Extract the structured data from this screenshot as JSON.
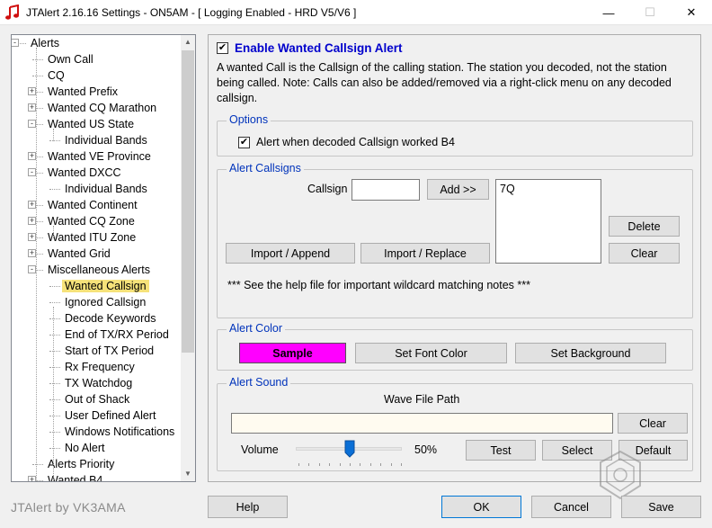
{
  "window": {
    "title": "JTAlert 2.16.16 Settings  -  ON5AM  -  [ Logging Enabled - HRD V5/V6 ]",
    "minimize": "—",
    "maximize": "☐",
    "close": "✕"
  },
  "tree": {
    "items": [
      {
        "label": "Alerts",
        "level": 0,
        "expander": "-"
      },
      {
        "label": "Own Call",
        "level": 1,
        "expander": ""
      },
      {
        "label": "CQ",
        "level": 1,
        "expander": ""
      },
      {
        "label": "Wanted Prefix",
        "level": 1,
        "expander": "+"
      },
      {
        "label": "Wanted CQ Marathon",
        "level": 1,
        "expander": "+"
      },
      {
        "label": "Wanted US State",
        "level": 1,
        "expander": "-"
      },
      {
        "label": "Individual Bands",
        "level": 2,
        "expander": ""
      },
      {
        "label": "Wanted VE Province",
        "level": 1,
        "expander": "+"
      },
      {
        "label": "Wanted DXCC",
        "level": 1,
        "expander": "-"
      },
      {
        "label": "Individual Bands",
        "level": 2,
        "expander": ""
      },
      {
        "label": "Wanted Continent",
        "level": 1,
        "expander": "+"
      },
      {
        "label": "Wanted CQ Zone",
        "level": 1,
        "expander": "+"
      },
      {
        "label": "Wanted ITU Zone",
        "level": 1,
        "expander": "+"
      },
      {
        "label": "Wanted Grid",
        "level": 1,
        "expander": "+"
      },
      {
        "label": "Miscellaneous Alerts",
        "level": 1,
        "expander": "-"
      },
      {
        "label": "Wanted Callsign",
        "level": 2,
        "expander": "",
        "selected": true
      },
      {
        "label": "Ignored Callsign",
        "level": 2,
        "expander": ""
      },
      {
        "label": "Decode Keywords",
        "level": 2,
        "expander": ""
      },
      {
        "label": "End of TX/RX Period",
        "level": 2,
        "expander": ""
      },
      {
        "label": "Start of TX Period",
        "level": 2,
        "expander": ""
      },
      {
        "label": "Rx Frequency",
        "level": 2,
        "expander": ""
      },
      {
        "label": "TX Watchdog",
        "level": 2,
        "expander": ""
      },
      {
        "label": "Out of Shack",
        "level": 2,
        "expander": ""
      },
      {
        "label": "User Defined Alert",
        "level": 2,
        "expander": ""
      },
      {
        "label": "Windows Notifications",
        "level": 2,
        "expander": ""
      },
      {
        "label": "No Alert",
        "level": 2,
        "expander": ""
      },
      {
        "label": "Alerts Priority",
        "level": 1,
        "expander": ""
      },
      {
        "label": "Wanted B4",
        "level": 1,
        "expander": "+"
      }
    ],
    "scroll_up": "▲",
    "scroll_down": "▼"
  },
  "main": {
    "enable_label": "Enable Wanted Callsign Alert",
    "enable_check": "✔",
    "description": "A wanted Call is the Callsign of the calling station. The station you decoded, not the station being called. Note: Calls can also be added/removed via a right-click menu on any decoded callsign.",
    "options": {
      "title": "Options",
      "worked_b4_label": "Alert when decoded Callsign worked B4",
      "worked_b4_check": "✔"
    },
    "callsigns": {
      "title": "Alert Callsigns",
      "callsign_label": "Callsign",
      "callsign_value": "",
      "add_label": "Add >>",
      "list": [
        "7Q"
      ],
      "delete_label": "Delete",
      "clear_label": "Clear",
      "import_append_label": "Import / Append",
      "import_replace_label": "Import / Replace",
      "note": "***  See the help file for important wildcard matching notes  ***"
    },
    "color": {
      "title": "Alert Color",
      "sample_label": "Sample",
      "sample_bg": "#ff00ff",
      "set_font_label": "Set Font Color",
      "set_bg_label": "Set Background"
    },
    "sound": {
      "title": "Alert Sound",
      "wave_label": "Wave File Path",
      "wave_value": "",
      "clear_label": "Clear",
      "volume_label": "Volume",
      "volume_value": "50%",
      "volume_level": 0.5,
      "test_label": "Test",
      "select_label": "Select",
      "default_label": "Default"
    }
  },
  "footer": {
    "brand": "JTAlert by VK3AMA",
    "help_label": "Help",
    "ok_label": "OK",
    "cancel_label": "Cancel",
    "save_label": "Save"
  }
}
